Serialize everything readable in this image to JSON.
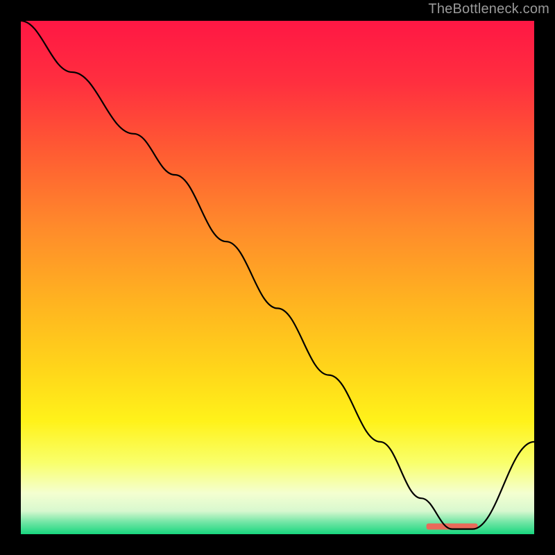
{
  "watermark": "TheBottleneck.com",
  "chart_data": {
    "type": "line",
    "title": "",
    "xlabel": "",
    "ylabel": "",
    "xlim": [
      0,
      100
    ],
    "ylim": [
      0,
      100
    ],
    "grid": false,
    "legend": false,
    "background_gradient_stops": [
      {
        "offset": 0.0,
        "color": "#ff1744"
      },
      {
        "offset": 0.12,
        "color": "#ff2f3f"
      },
      {
        "offset": 0.25,
        "color": "#ff5a33"
      },
      {
        "offset": 0.4,
        "color": "#ff8a2b"
      },
      {
        "offset": 0.55,
        "color": "#ffb420"
      },
      {
        "offset": 0.68,
        "color": "#ffd61a"
      },
      {
        "offset": 0.78,
        "color": "#fff21a"
      },
      {
        "offset": 0.86,
        "color": "#f9ff6a"
      },
      {
        "offset": 0.92,
        "color": "#f4ffd0"
      },
      {
        "offset": 0.955,
        "color": "#d8f8cf"
      },
      {
        "offset": 0.975,
        "color": "#79e7a8"
      },
      {
        "offset": 1.0,
        "color": "#18d67e"
      }
    ],
    "series": [
      {
        "name": "bottleneck-curve",
        "stroke": "#000000",
        "stroke_width": 2.2,
        "x": [
          0,
          10,
          22,
          30,
          40,
          50,
          60,
          70,
          78,
          84,
          88,
          100
        ],
        "y": [
          100,
          90,
          78,
          70,
          57,
          44,
          31,
          18,
          7,
          1,
          1,
          18
        ]
      }
    ],
    "marker": {
      "name": "optimal-range",
      "color": "#e96a5a",
      "x_start": 79,
      "x_end": 89,
      "y": 1.5,
      "height_frac": 0.012
    }
  }
}
